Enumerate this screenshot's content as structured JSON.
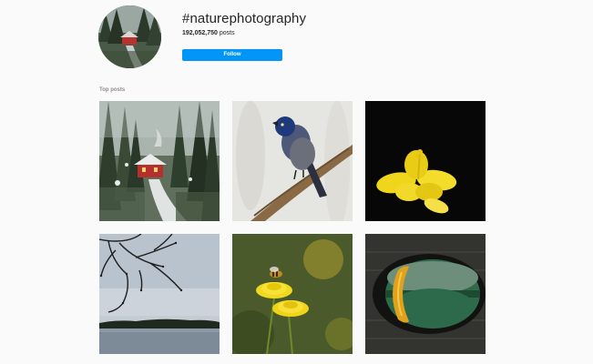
{
  "hashtag": {
    "title": "#naturephotography",
    "post_count": "192,052,750",
    "post_count_suffix": " posts",
    "follow_label": "Follow"
  },
  "top_posts": {
    "label": "Top posts",
    "items": [
      {
        "subject": "snowy forest cabin"
      },
      {
        "subject": "bird on branch"
      },
      {
        "subject": "yellow flower on black"
      },
      {
        "subject": "bare branches over lake"
      },
      {
        "subject": "bee on dandelions"
      },
      {
        "subject": "green lake through stone arch"
      }
    ]
  },
  "colors": {
    "accent": "#0095f6",
    "background": "#fafafa",
    "text": "#262626",
    "muted": "#8e8e8e"
  }
}
